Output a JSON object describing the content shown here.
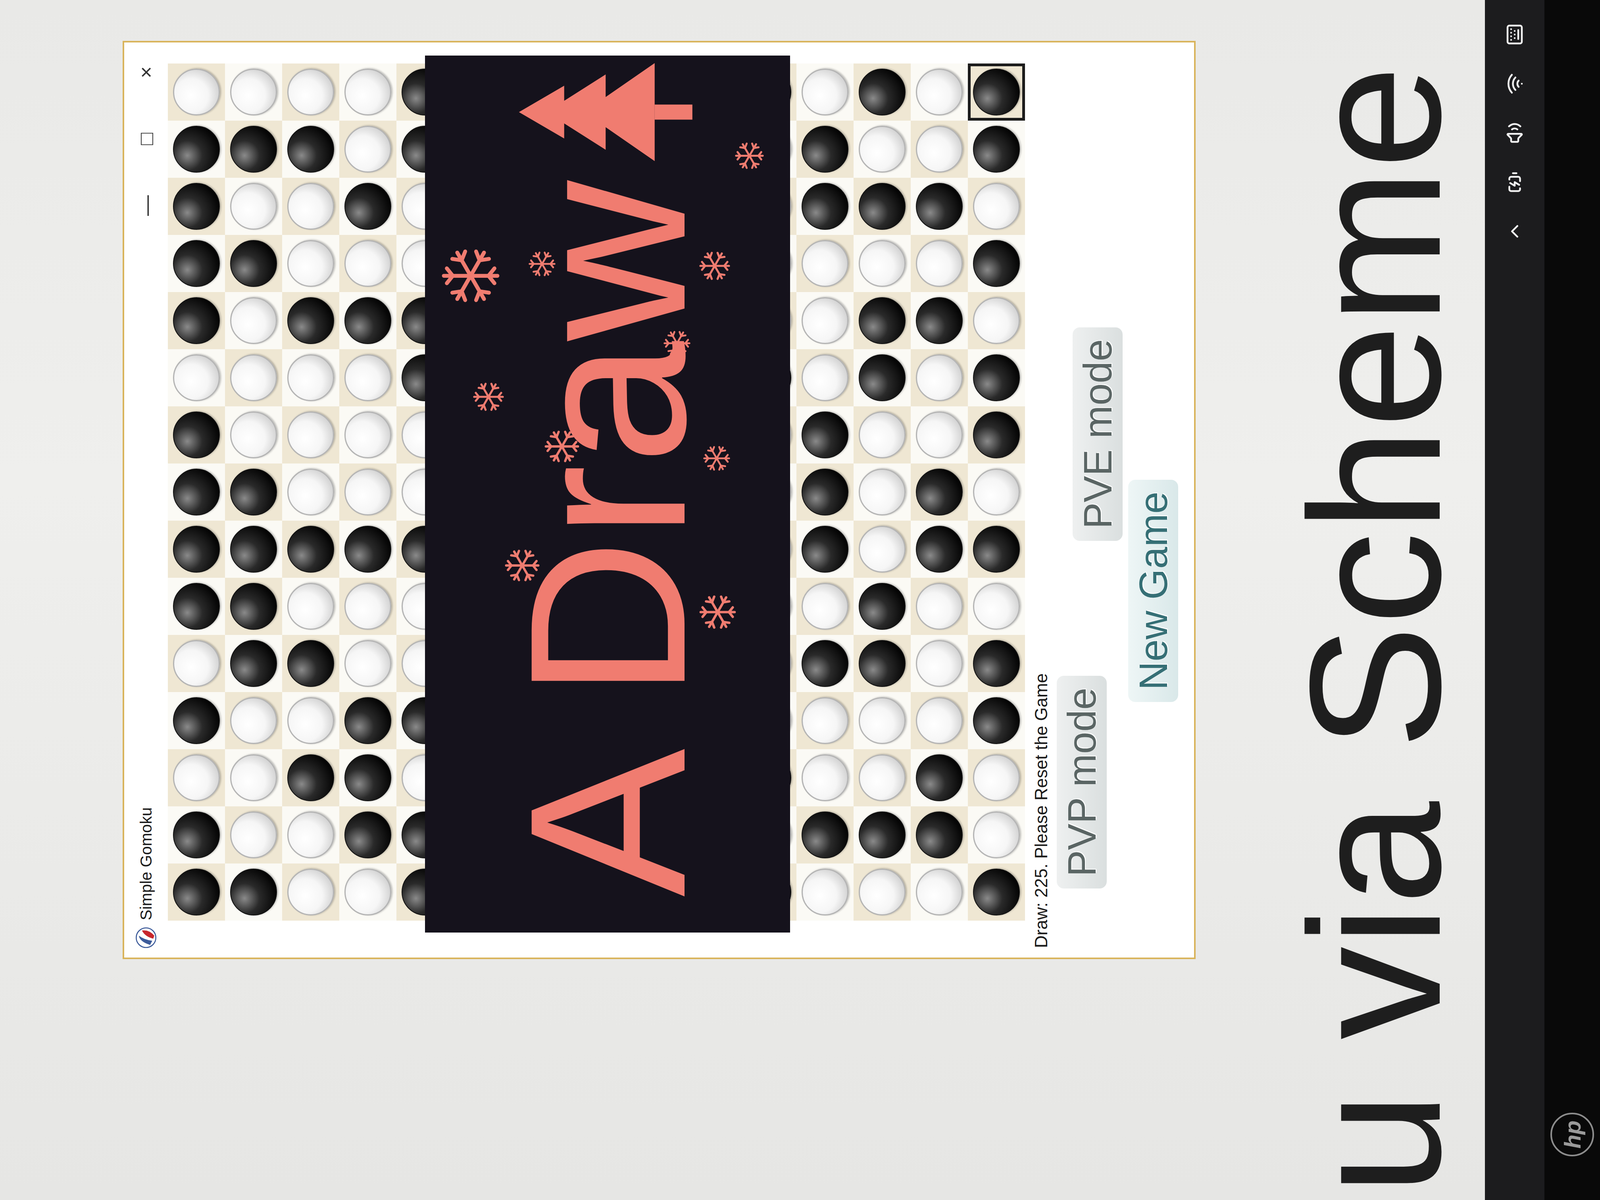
{
  "window": {
    "title": "Simple Gomoku",
    "controls": [
      "—",
      "□",
      "×"
    ]
  },
  "board": {
    "rows": [
      "BBWBWBBBBWBBBBW",
      "BWWWBBBBWWWBWBW",
      "WWBWBWBWWWBWWBW",
      "WBBBWWBWWWBWBWW",
      "BBWBWWBWWBBWWBB",
      "WWBWBBWBBWWBBWW",
      "BWBBWWBWWBBWWBW",
      "WBWWBBWBBWWBBWB",
      "BWBBWWBWWBBWWBW",
      "WBWWBWBBWWBBWBW",
      "BWBWWWWWWBWWWWB",
      "WBWWBWBBBWWWBBW",
      "WBWWBBWWWBBWBWB",
      "WBBWWWBBWWBWBWW",
      "BWWBBWBWBBWBWBB"
    ],
    "last_move": {
      "row": 14,
      "col": 14
    }
  },
  "banner": {
    "text": "A Draw"
  },
  "status": "Draw: 225. Please Reset the Game",
  "buttons": [
    {
      "label": "PVP mode",
      "highlighted": false
    },
    {
      "label": "PVE mode",
      "highlighted": false
    },
    {
      "label": "New Game",
      "highlighted": true
    }
  ],
  "slide": {
    "text": "u via Scheme"
  },
  "monitor": {
    "logo": "hp"
  }
}
